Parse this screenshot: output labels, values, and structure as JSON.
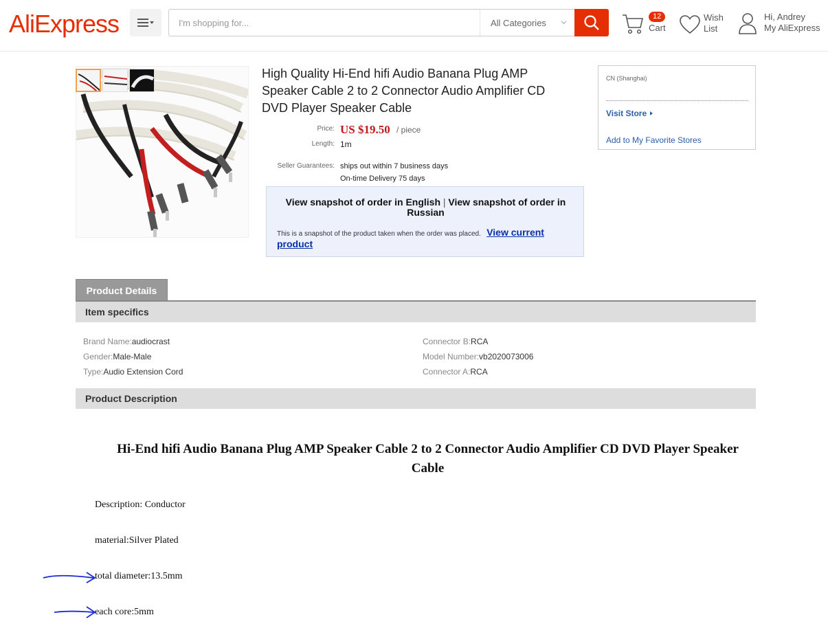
{
  "header": {
    "logo": "AliExpress",
    "search_placeholder": "I'm shopping for...",
    "category": "All Categories",
    "cart_count": "12",
    "cart_label": "Cart",
    "wish_label": "Wish List",
    "greeting": "Hi, Andrey",
    "account_label": "My AliExpress"
  },
  "product": {
    "title": "High Quality Hi-End hifi Audio Banana Plug AMP Speaker Cable 2 to 2 Connector Audio Amplifier CD DVD Player Speaker Cable",
    "price_label": "Price:",
    "price": "US $19.50",
    "unit": "/ piece",
    "length_label": "Length:",
    "length": "1m",
    "guarantee_label": "Seller Guarantees:",
    "guarantee_1": "ships out within 7 business days",
    "guarantee_2": "On-time Delivery 75 days"
  },
  "snapshot": {
    "english": "View snapshot of order in English",
    "separator": "|",
    "russian": "View snapshot of order in Russian",
    "note": "This is a snapshot of the product taken when the order was placed.",
    "view_current": "View current product"
  },
  "store": {
    "location": "CN (Shanghai)",
    "visit": "Visit Store",
    "favorite": "Add to My Favorite Stores"
  },
  "details": {
    "tab": "Product Details",
    "specifics_heading": "Item specifics",
    "description_heading": "Product Description",
    "specs_left": [
      {
        "key": "Brand Name:",
        "value": "audiocrast"
      },
      {
        "key": "Gender:",
        "value": "Male-Male"
      },
      {
        "key": "Type:",
        "value": "Audio Extension Cord"
      }
    ],
    "specs_right": [
      {
        "key": "Connector B:",
        "value": "RCA"
      },
      {
        "key": "Model Number:",
        "value": "vb2020073006"
      },
      {
        "key": "Connector A:",
        "value": "RCA"
      }
    ]
  },
  "description": {
    "title": "Hi-End hifi Audio Banana Plug AMP Speaker Cable 2 to 2 Connector Audio Amplifier CD DVD Player Speaker Cable",
    "lines": [
      "Description: Conductor",
      "material:Silver Plated",
      "total diameter:13.5mm",
      "each core:5mm"
    ]
  },
  "colors": {
    "brand": "#e62e04",
    "price": "#c4171b",
    "link": "#2b5ea8"
  }
}
